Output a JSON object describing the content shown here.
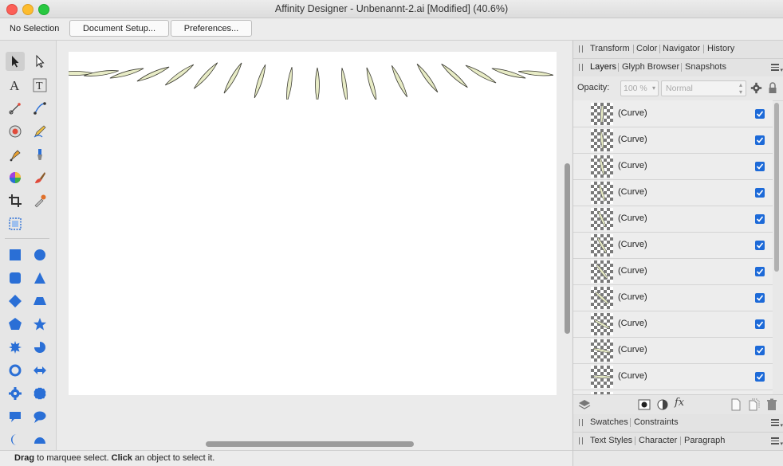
{
  "window": {
    "title": "Affinity Designer - Unbenannt-2.ai [Modified] (40.6%)"
  },
  "context_toolbar": {
    "selection": "No Selection",
    "doc_setup_label": "Document Setup...",
    "preferences_label": "Preferences..."
  },
  "tools": [
    "move-tool-icon",
    "node-tool-icon",
    "artistic-text-tool-icon",
    "frame-text-tool-icon",
    "point-transform-tool-icon",
    "corner-tool-icon",
    "transparency-tool-icon",
    "pencil-tool-icon",
    "pen-tool-icon",
    "vector-brush-tool-icon",
    "fill-tool-icon",
    "paint-brush-tool-icon",
    "crop-tool-icon",
    "color-picker-tool-icon",
    "place-image-tool-icon",
    "rectangle-tool-icon",
    "ellipse-tool-icon",
    "rounded-rectangle-tool-icon",
    "triangle-tool-icon",
    "diamond-tool-icon",
    "trapezoid-tool-icon",
    "polygon-tool-icon",
    "star-tool-icon",
    "cog-tool-icon",
    "pie-tool-icon",
    "donut-tool-icon",
    "double-arrow-tool-icon",
    "gear-tool-icon",
    "cloud-tool-icon",
    "callout-rectangle-tool-icon",
    "callout-ellipse-tool-icon",
    "crescent-tool-icon",
    "segment-tool-icon"
  ],
  "panels": {
    "top_tabs": [
      "Transform",
      "Color",
      "Navigator",
      "History"
    ],
    "layer_tabs": [
      "Layers",
      "Glyph Browser",
      "Snapshots"
    ],
    "opacity_label": "Opacity:",
    "opacity_value": "100 %",
    "blend_mode": "Normal",
    "swatches_tabs": [
      "Swatches",
      "Constraints"
    ],
    "text_tabs": [
      "Text Styles",
      "Character",
      "Paragraph"
    ]
  },
  "layers": [
    {
      "name": "(Curve)",
      "visible": true
    },
    {
      "name": "(Curve)",
      "visible": true
    },
    {
      "name": "(Curve)",
      "visible": true
    },
    {
      "name": "(Curve)",
      "visible": true
    },
    {
      "name": "(Curve)",
      "visible": true
    },
    {
      "name": "(Curve)",
      "visible": true
    },
    {
      "name": "(Curve)",
      "visible": true
    },
    {
      "name": "(Curve)",
      "visible": true
    },
    {
      "name": "(Curve)",
      "visible": true
    },
    {
      "name": "(Curve)",
      "visible": true
    },
    {
      "name": "(Curve)",
      "visible": true
    }
  ],
  "status": {
    "drag_word": "Drag",
    "drag_text": " to marquee select. ",
    "click_word": "Click",
    "click_text": " an object to select it."
  },
  "colors": {
    "leaf_fill": "#e8ecc6",
    "leaf_stroke": "#3a3a30",
    "accent": "#1d6ad8"
  }
}
